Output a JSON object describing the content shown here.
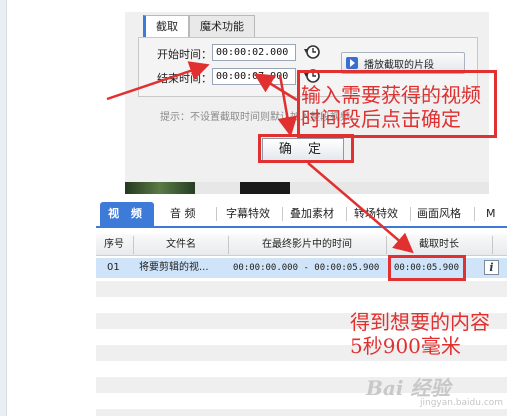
{
  "dialog": {
    "tabs": [
      "截取",
      "魔术功能"
    ],
    "start_label": "开始时间：",
    "start_value": "00:00:02.000",
    "end_label": "结束时间：",
    "end_value": "00:00:07.900",
    "play_button": "播放截取的片段",
    "hint": "提示：不设置截取时间则默认加入整段视频。",
    "confirm_button": "确 定"
  },
  "annotations": {
    "top_line1": "输入需要获得的视频",
    "top_line2": "时间段后点击确定",
    "bottom_line1": "得到想要的内容",
    "bottom_line2": "5秒900毫米",
    "color": "#e03030"
  },
  "editor": {
    "tabs": [
      "视 频",
      "音 频",
      "字幕特效",
      "叠加素材",
      "转场特效",
      "画面风格",
      "M"
    ],
    "columns": [
      "序号",
      "文件名",
      "在最终影片中的时间",
      "截取时长"
    ],
    "rows": [
      {
        "index": "01",
        "filename": "将要剪辑的视...",
        "range": "00:00:00.000 - 00:00:05.900",
        "duration": "00:00:05.900",
        "info": "i"
      }
    ],
    "accent": "#3e7bd8"
  },
  "watermark": {
    "text": "Bai 经验",
    "sub": "jingyan.baidu.com"
  }
}
